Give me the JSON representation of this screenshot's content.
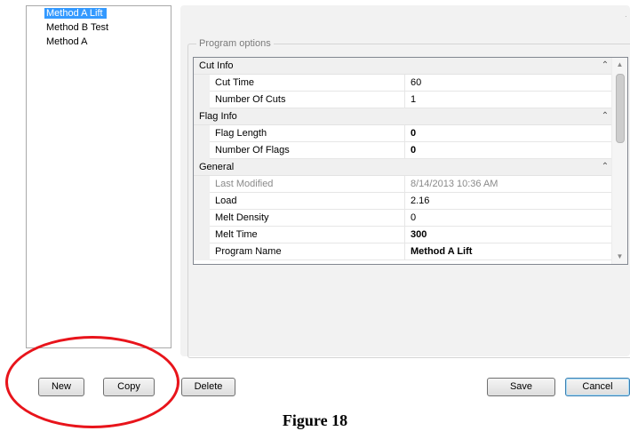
{
  "methods": [
    {
      "label": "Method A Lift",
      "selected": true
    },
    {
      "label": "Method B Test",
      "selected": false
    },
    {
      "label": "Method A",
      "selected": false
    }
  ],
  "program_options": {
    "legend": "Program options",
    "categories": [
      {
        "label": "Cut Info",
        "properties": [
          {
            "name": "Cut Time",
            "value": "60"
          },
          {
            "name": "Number Of Cuts",
            "value": "1"
          }
        ]
      },
      {
        "label": "Flag Info",
        "properties": [
          {
            "name": "Flag Length",
            "value": "0",
            "bold": true
          },
          {
            "name": "Number Of Flags",
            "value": "0",
            "bold": true
          }
        ]
      },
      {
        "label": "General",
        "properties": [
          {
            "name": "Last Modified",
            "value": "8/14/2013 10:36 AM",
            "readonly": true
          },
          {
            "name": "Load",
            "value": "2.16"
          },
          {
            "name": "Melt Density",
            "value": "0"
          },
          {
            "name": "Melt Time",
            "value": "300",
            "bold": true
          },
          {
            "name": "Program Name",
            "value": "Method A Lift",
            "bold": true
          }
        ]
      }
    ]
  },
  "buttons": {
    "new": "New",
    "copy": "Copy",
    "delete": "Delete",
    "save": "Save",
    "cancel": "Cancel"
  },
  "caption": "Figure 18",
  "annotation_color": "#e8141b",
  "selection_color": "#3399ff"
}
